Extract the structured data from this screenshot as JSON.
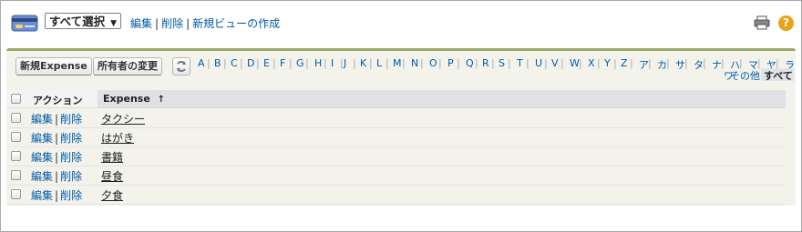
{
  "view_selector": {
    "label": "すべて選択",
    "arrow": "▼"
  },
  "header_links": {
    "edit": "編集",
    "delete": "削除",
    "new_view": "新規ビューの作成",
    "separator": "|"
  },
  "icons": {
    "logo": "credit-card-icon",
    "print": "printer-icon",
    "help": "help-icon",
    "refresh": "refresh-icon"
  },
  "help_glyph": "?",
  "buttons": {
    "new": "新規Expense",
    "change_owner": "所有者の変更"
  },
  "letters": [
    "A",
    "B",
    "C",
    "D",
    "E",
    "F",
    "G",
    "H",
    "I",
    "J",
    "K",
    "L",
    "M",
    "N",
    "O",
    "P",
    "Q",
    "R",
    "S",
    "T",
    "U",
    "V",
    "W",
    "X",
    "Y",
    "Z",
    "ア",
    "カ",
    "サ",
    "タ",
    "ナ",
    "ハ",
    "マ",
    "ヤ",
    "ラ"
  ],
  "letters_row2": {
    "wa": "ワ",
    "other": "その他",
    "all": "すべて"
  },
  "table": {
    "headers": {
      "action": "アクション",
      "name": "Expense",
      "sort_indicator": "↑"
    },
    "rows": [
      {
        "edit": "編集",
        "delete": "削除",
        "name": "タクシー"
      },
      {
        "edit": "編集",
        "delete": "削除",
        "name": "はがき"
      },
      {
        "edit": "編集",
        "delete": "削除",
        "name": "書籍"
      },
      {
        "edit": "編集",
        "delete": "削除",
        "name": "昼食"
      },
      {
        "edit": "編集",
        "delete": "削除",
        "name": "夕食"
      }
    ]
  },
  "colors": {
    "link": "#015ba7",
    "accent": "#9aa868",
    "help": "#e8a317"
  }
}
